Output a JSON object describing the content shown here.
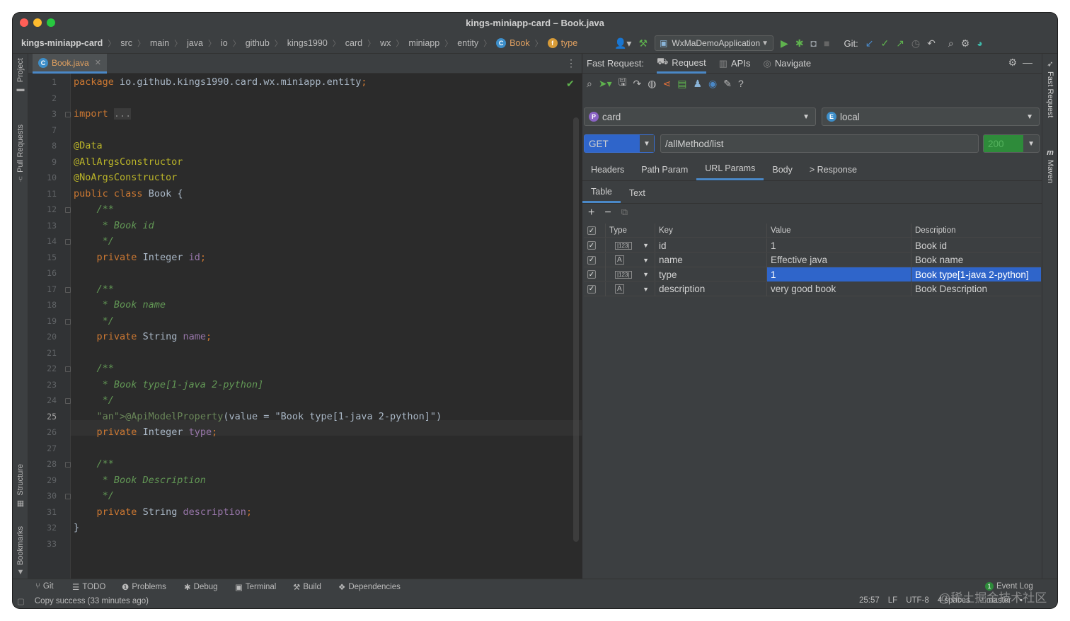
{
  "window": {
    "title": "kings-miniapp-card – Book.java"
  },
  "breadcrumb": {
    "project": "kings-miniapp-card",
    "items": [
      "src",
      "main",
      "java",
      "io",
      "github",
      "kings1990",
      "card",
      "wx",
      "miniapp",
      "entity"
    ],
    "class": "Book",
    "field": "type"
  },
  "toolbar": {
    "run_config": "WxMaDemoApplication",
    "git_label": "Git:"
  },
  "left_tabs": {
    "project": "Project",
    "pull_requests": "Pull Requests",
    "structure": "Structure",
    "bookmarks": "Bookmarks"
  },
  "right_tabs": {
    "fast_request": "Fast Request",
    "maven": "Maven"
  },
  "editor": {
    "tab_label": "Book.java",
    "current_line": "25",
    "lines": [
      {
        "n": "1",
        "t": "package io.github.kings1990.card.wx.miniapp.entity;"
      },
      {
        "n": "2",
        "t": ""
      },
      {
        "n": "3",
        "t": "import ..."
      },
      {
        "n": "7",
        "t": ""
      },
      {
        "n": "8",
        "t": "@Data"
      },
      {
        "n": "9",
        "t": "@AllArgsConstructor"
      },
      {
        "n": "10",
        "t": "@NoArgsConstructor"
      },
      {
        "n": "11",
        "t": "public class Book {"
      },
      {
        "n": "12",
        "t": "    /**"
      },
      {
        "n": "13",
        "t": "     * Book id"
      },
      {
        "n": "14",
        "t": "     */"
      },
      {
        "n": "15",
        "t": "    private Integer id;"
      },
      {
        "n": "16",
        "t": ""
      },
      {
        "n": "17",
        "t": "    /**"
      },
      {
        "n": "18",
        "t": "     * Book name"
      },
      {
        "n": "19",
        "t": "     */"
      },
      {
        "n": "20",
        "t": "    private String name;"
      },
      {
        "n": "21",
        "t": ""
      },
      {
        "n": "22",
        "t": "    /**"
      },
      {
        "n": "23",
        "t": "     * Book type[1-java 2-python]"
      },
      {
        "n": "24",
        "t": "     */"
      },
      {
        "n": "25",
        "t": "    @ApiModelProperty(value = \"Book type[1-java 2-python]\")"
      },
      {
        "n": "26",
        "t": "    private Integer type;"
      },
      {
        "n": "27",
        "t": ""
      },
      {
        "n": "28",
        "t": "    /**"
      },
      {
        "n": "29",
        "t": "     * Book Description"
      },
      {
        "n": "30",
        "t": "     */"
      },
      {
        "n": "31",
        "t": "    private String description;"
      },
      {
        "n": "32",
        "t": "}"
      },
      {
        "n": "33",
        "t": ""
      }
    ]
  },
  "fast_request": {
    "title": "Fast Request:",
    "tabs": [
      "Request",
      "APIs",
      "Navigate"
    ],
    "project_select": "card",
    "env_select": "local",
    "method": "GET",
    "url": "/allMethod/list",
    "status_code": "200",
    "request_tabs": [
      "Headers",
      "Path Param",
      "URL Params",
      "Body",
      "> Response"
    ],
    "active_request_tab": "URL Params",
    "view_tabs": [
      "Table",
      "Text"
    ],
    "columns": [
      "Type",
      "Key",
      "Value",
      "Description"
    ],
    "rows": [
      {
        "type_icon": "number",
        "key": "id",
        "value": "1",
        "description": "Book id"
      },
      {
        "type_icon": "text",
        "key": "name",
        "value": "Effective java",
        "description": "Book name"
      },
      {
        "type_icon": "number",
        "key": "type",
        "value": "1",
        "description": "Book type[1-java 2-python]",
        "selected": true
      },
      {
        "type_icon": "text",
        "key": "description",
        "value": "very good book",
        "description": "Book Description"
      }
    ]
  },
  "bottom_tabs": [
    "Git",
    "TODO",
    "Problems",
    "Debug",
    "Terminal",
    "Build",
    "Dependencies"
  ],
  "status": {
    "message": "Copy success (33 minutes ago)",
    "position": "25:57",
    "line_sep": "LF",
    "encoding": "UTF-8",
    "indent": "4 spaces",
    "branch": "master",
    "event_log": "Event Log",
    "event_count": "1"
  },
  "watermark": "@稀土掘金技术社区",
  "colors": {
    "accent": "#4a88c7",
    "selected_row": "#2f65ca",
    "status_ok": "#2e8b3a",
    "keyword": "#cc7832",
    "annotation": "#bbb529",
    "comment": "#629755"
  }
}
